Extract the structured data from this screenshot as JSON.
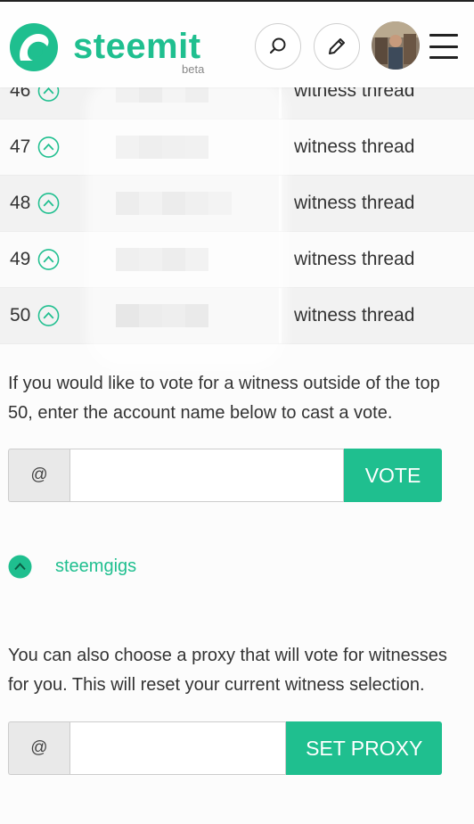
{
  "header": {
    "brand": "steemit",
    "badge": "beta",
    "icons": [
      "steemit-logo-icon",
      "search-icon",
      "pencil-icon",
      "avatar",
      "hamburger-menu-icon"
    ]
  },
  "witness_table": {
    "rows": [
      {
        "rank": "46",
        "name": "witness thread"
      },
      {
        "rank": "47",
        "name": "witness thread"
      },
      {
        "rank": "48",
        "name": "witness thread"
      },
      {
        "rank": "49",
        "name": "witness thread"
      },
      {
        "rank": "50",
        "name": "witness thread"
      }
    ]
  },
  "vote_section": {
    "description": "If you would like to vote for a witness outside of the top 50, enter the account name below to cast a vote.",
    "prefix": "@",
    "input_value": "",
    "button_label": "VOTE"
  },
  "voted_witness": {
    "name": "steemgigs"
  },
  "proxy_section": {
    "description": "You can also choose a proxy that will vote for witnesses for you. This will reset your current witness selection.",
    "prefix": "@",
    "input_value": "",
    "button_label": "SET PROXY"
  },
  "colors": {
    "accent": "#1fbf8f",
    "text": "#333333",
    "row_alt": "#f2f2f2"
  }
}
